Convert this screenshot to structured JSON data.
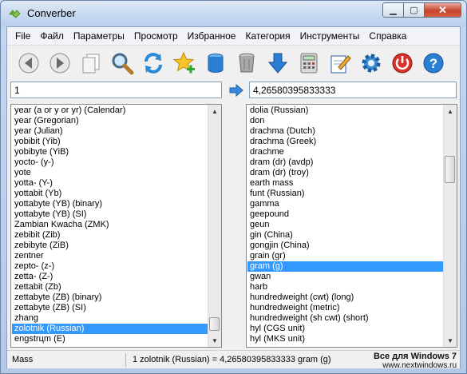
{
  "window": {
    "title": "Converber",
    "close_glyph": "✕",
    "min_glyph": "▁",
    "max_glyph": "▢"
  },
  "menu": [
    "File",
    "Файл",
    "Параметры",
    "Просмотр",
    "Избранное",
    "Категория",
    "Инструменты",
    "Справка"
  ],
  "toolbar": {
    "icons": [
      "back-arrow-icon",
      "forward-arrow-icon",
      "copy-icon",
      "magnifier-icon",
      "swap-refresh-icon",
      "add-favorite-star-icon",
      "database-icon",
      "trash-bin-icon",
      "download-arrow-icon",
      "calculator-icon",
      "edit-notepad-icon",
      "settings-gear-icon",
      "power-icon",
      "help-icon"
    ]
  },
  "input": {
    "value": "1",
    "result": "4,26580395833333"
  },
  "from_list": {
    "items": [
      "year (a or y or yr) (Calendar)",
      "year (Gregorian)",
      "year (Julian)",
      "yobibit (Yib)",
      "yobibyte (YiB)",
      "yocto- (y-)",
      "yote",
      "yotta- (Y-)",
      "yottabit (Yb)",
      "yottabyte (YB) (binary)",
      "yottabyte (YB) (SI)",
      "Zambian Kwacha (ZMK)",
      "zebibit (Zib)",
      "zebibyte (ZiB)",
      "zentner",
      "zepto- (z-)",
      "zetta- (Z-)",
      "zettabit (Zb)",
      "zettabyte (ZB) (binary)",
      "zettabyte (ZB) (SI)",
      "zhang",
      "zolotnik (Russian)",
      "engstrцm (E)"
    ],
    "selected": "zolotnik (Russian)"
  },
  "to_list": {
    "items": [
      "dolia (Russian)",
      "don",
      "drachma (Dutch)",
      "drachma (Greek)",
      "drachme",
      "dram (dr) (avdp)",
      "dram (dr) (troy)",
      "earth mass",
      "funt (Russian)",
      "gamma",
      "geepound",
      "geun",
      "gin (China)",
      "gongjin (China)",
      "grain (gr)",
      "gram (g)",
      "gwan",
      "harb",
      "hundredweight (cwt) (long)",
      "hundredweight (metric)",
      "hundredweight (sh cwt) (short)",
      "hyl (CGS unit)",
      "hyl (MKS unit)"
    ],
    "selected": "gram (g)"
  },
  "status": {
    "category": "Mass",
    "conversion": "1 zolotnik (Russian) = 4,26580395833333 gram (g)",
    "watermark_line1": "Все для Windows 7",
    "watermark_line2": "www.nextwindows.ru"
  },
  "scroll_arrows": {
    "up": "▲",
    "down": "▼"
  }
}
